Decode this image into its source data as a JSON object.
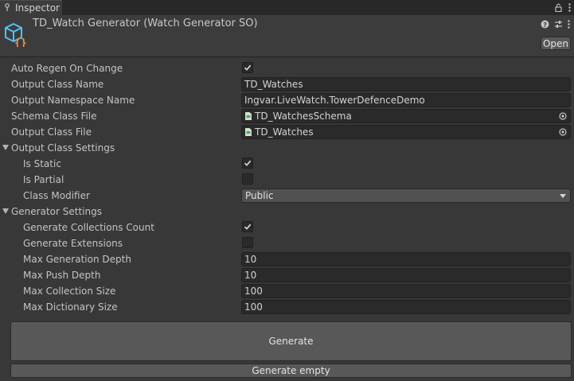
{
  "window": {
    "tab_label": "Inspector"
  },
  "header": {
    "title": "TD_Watch Generator (Watch Generator SO)",
    "open_label": "Open",
    "icons": [
      "lock-icon",
      "menu-icon",
      "help-icon",
      "preset-icon",
      "more-icon"
    ]
  },
  "fields": {
    "auto_regen": {
      "label": "Auto Regen On Change",
      "checked": true
    },
    "output_class_name": {
      "label": "Output Class Name",
      "value": "TD_Watches"
    },
    "output_namespace": {
      "label": "Output Namespace Name",
      "value": "Ingvar.LiveWatch.TowerDefenceDemo"
    },
    "schema_class_file": {
      "label": "Schema Class File",
      "value": "TD_WatchesSchema"
    },
    "output_class_file": {
      "label": "Output Class File",
      "value": "TD_Watches"
    }
  },
  "output_class_settings": {
    "label": "Output Class Settings",
    "is_static": {
      "label": "Is Static",
      "checked": true
    },
    "is_partial": {
      "label": "Is Partial",
      "checked": false
    },
    "class_modifier": {
      "label": "Class Modifier",
      "value": "Public"
    }
  },
  "generator_settings": {
    "label": "Generator Settings",
    "gen_collections_count": {
      "label": "Generate Collections Count",
      "checked": true
    },
    "gen_extensions": {
      "label": "Generate Extensions",
      "checked": false
    },
    "max_gen_depth": {
      "label": "Max Generation Depth",
      "value": "10"
    },
    "max_push_depth": {
      "label": "Max Push Depth",
      "value": "10"
    },
    "max_collection_size": {
      "label": "Max Collection Size",
      "value": "100"
    },
    "max_dictionary_size": {
      "label": "Max Dictionary Size",
      "value": "100"
    }
  },
  "actions": {
    "generate_label": "Generate",
    "generate_empty_label": "Generate empty"
  },
  "colors": {
    "background": "#383838",
    "field": "#2a2a2a",
    "button": "#585858",
    "icon_blue": "#4fc3f7",
    "icon_orange": "#f0913f"
  }
}
